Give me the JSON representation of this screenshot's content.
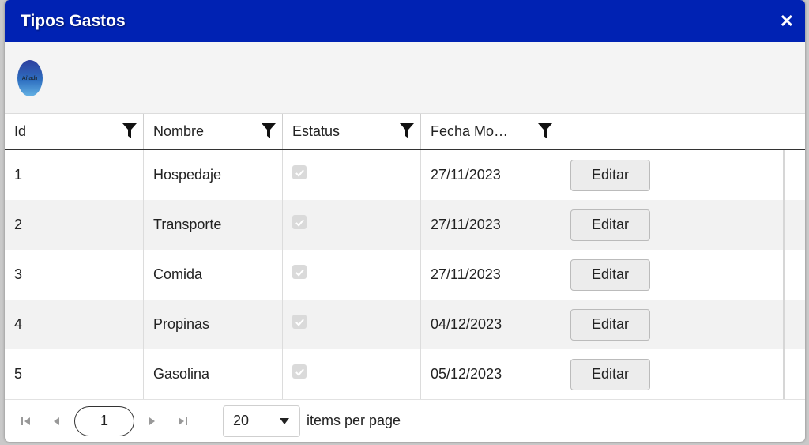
{
  "dialog": {
    "title": "Tipos Gastos"
  },
  "toolbar": {
    "add_label": "Añadir"
  },
  "grid": {
    "columns": [
      "Id",
      "Nombre",
      "Estatus",
      "Fecha Mo…",
      ""
    ],
    "rows": [
      {
        "id": "1",
        "nombre": "Hospedaje",
        "estatus": true,
        "fecha": "27/11/2023",
        "action": "Editar"
      },
      {
        "id": "2",
        "nombre": "Transporte",
        "estatus": true,
        "fecha": "27/11/2023",
        "action": "Editar"
      },
      {
        "id": "3",
        "nombre": "Comida",
        "estatus": true,
        "fecha": "27/11/2023",
        "action": "Editar"
      },
      {
        "id": "4",
        "nombre": "Propinas",
        "estatus": true,
        "fecha": "04/12/2023",
        "action": "Editar"
      },
      {
        "id": "5",
        "nombre": "Gasolina",
        "estatus": true,
        "fecha": "05/12/2023",
        "action": "Editar"
      }
    ]
  },
  "pager": {
    "current_page": "1",
    "page_size": "20",
    "items_per_page_label": "items per page"
  },
  "colors": {
    "titlebar": "#0022b3",
    "toolbar_bg": "#f4f4f4",
    "row_alt": "#f2f2f2",
    "button_bg": "#ececec"
  },
  "icons": {
    "close": "close-icon",
    "filter": "filter-icon",
    "checkbox": "checkmark-icon",
    "first": "first-page-icon",
    "prev": "prev-page-icon",
    "next": "next-page-icon",
    "last": "last-page-icon",
    "dropdown": "chevron-down-icon"
  }
}
